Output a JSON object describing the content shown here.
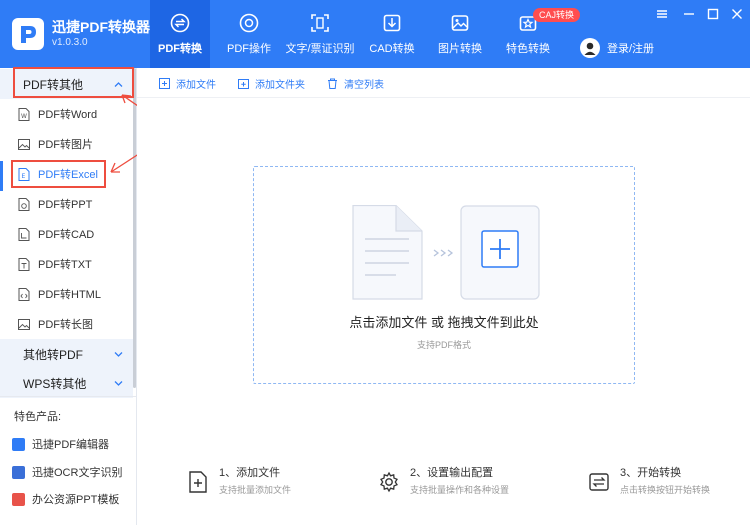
{
  "app": {
    "title": "迅捷PDF转换器",
    "version": "v1.0.3.0"
  },
  "nav": {
    "tabs": [
      {
        "label": "PDF转换",
        "icon": "convert-icon"
      },
      {
        "label": "PDF操作",
        "icon": "pdf-operation-icon"
      },
      {
        "label": "文字/票证识别",
        "icon": "ocr-scan-icon"
      },
      {
        "label": "CAD转换",
        "icon": "cad-icon"
      },
      {
        "label": "图片转换",
        "icon": "image-icon"
      },
      {
        "label": "特色转换",
        "icon": "special-icon"
      }
    ],
    "badge": "CAJ转换",
    "login": "登录/注册"
  },
  "sidebar": {
    "group_main": "PDF转其他",
    "items": [
      {
        "label": "PDF转Word",
        "icon": "word-file-icon"
      },
      {
        "label": "PDF转图片",
        "icon": "picture-file-icon"
      },
      {
        "label": "PDF转Excel",
        "icon": "excel-file-icon"
      },
      {
        "label": "PDF转PPT",
        "icon": "ppt-file-icon"
      },
      {
        "label": "PDF转CAD",
        "icon": "cad-file-icon"
      },
      {
        "label": "PDF转TXT",
        "icon": "txt-file-icon"
      },
      {
        "label": "PDF转HTML",
        "icon": "html-file-icon"
      },
      {
        "label": "PDF转长图",
        "icon": "long-image-icon"
      }
    ],
    "group_other": "其他转PDF",
    "group_wps": "WPS转其他",
    "featured_title": "特色产品:",
    "featured": [
      {
        "label": "迅捷PDF编辑器",
        "color": "#2f7cf6"
      },
      {
        "label": "迅捷OCR文字识别",
        "color": "#3a6fd8"
      },
      {
        "label": "办公资源PPT模板",
        "color": "#e8534a"
      }
    ]
  },
  "toolbar": {
    "add_file": "添加文件",
    "add_folder": "添加文件夹",
    "clear_list": "清空列表"
  },
  "dropzone": {
    "text": "点击添加文件 或 拖拽文件到此处",
    "sub": "支持PDF格式"
  },
  "steps": [
    {
      "title": "1、添加文件",
      "sub": "支持批量添加文件",
      "icon": "add-file-icon"
    },
    {
      "title": "2、设置输出配置",
      "sub": "支持批量操作和各种设置",
      "icon": "settings-gear-icon"
    },
    {
      "title": "3、开始转换",
      "sub": "点击转换按钮开始转换",
      "icon": "start-convert-icon"
    }
  ],
  "colors": {
    "brand": "#2f7cf6",
    "brand_dark": "#1e66e4",
    "annotation_red": "#ee4d3f",
    "badge_red": "#ff4d4f"
  }
}
